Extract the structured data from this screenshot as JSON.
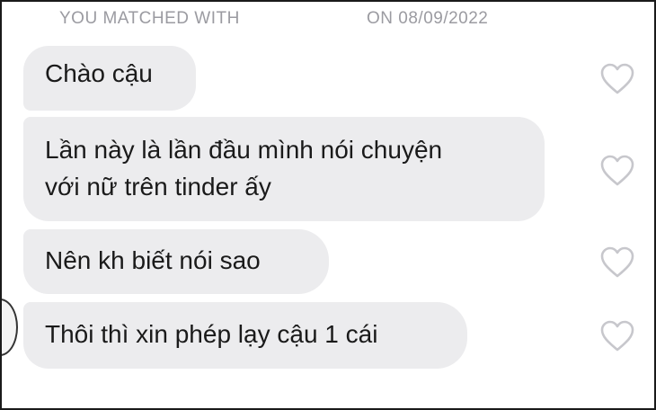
{
  "header": {
    "matched_text": "YOU MATCHED WITH",
    "date_text": "ON 08/09/2022"
  },
  "messages": [
    {
      "lines": [
        "Chào cậu"
      ]
    },
    {
      "lines": [
        "Lần này là lần đầu mình nói chuyện",
        "với nữ trên tinder ấy"
      ]
    },
    {
      "lines": [
        "Nên kh biết nói sao"
      ]
    },
    {
      "lines": [
        "Thôi thì xin phép lạy cậu 1 cái"
      ]
    }
  ],
  "colors": {
    "bubble_background": "#ececee",
    "header_text": "#9b9ba1",
    "heart_outline": "#c7c7cc"
  },
  "icons": {
    "like": "heart-outline-icon"
  }
}
